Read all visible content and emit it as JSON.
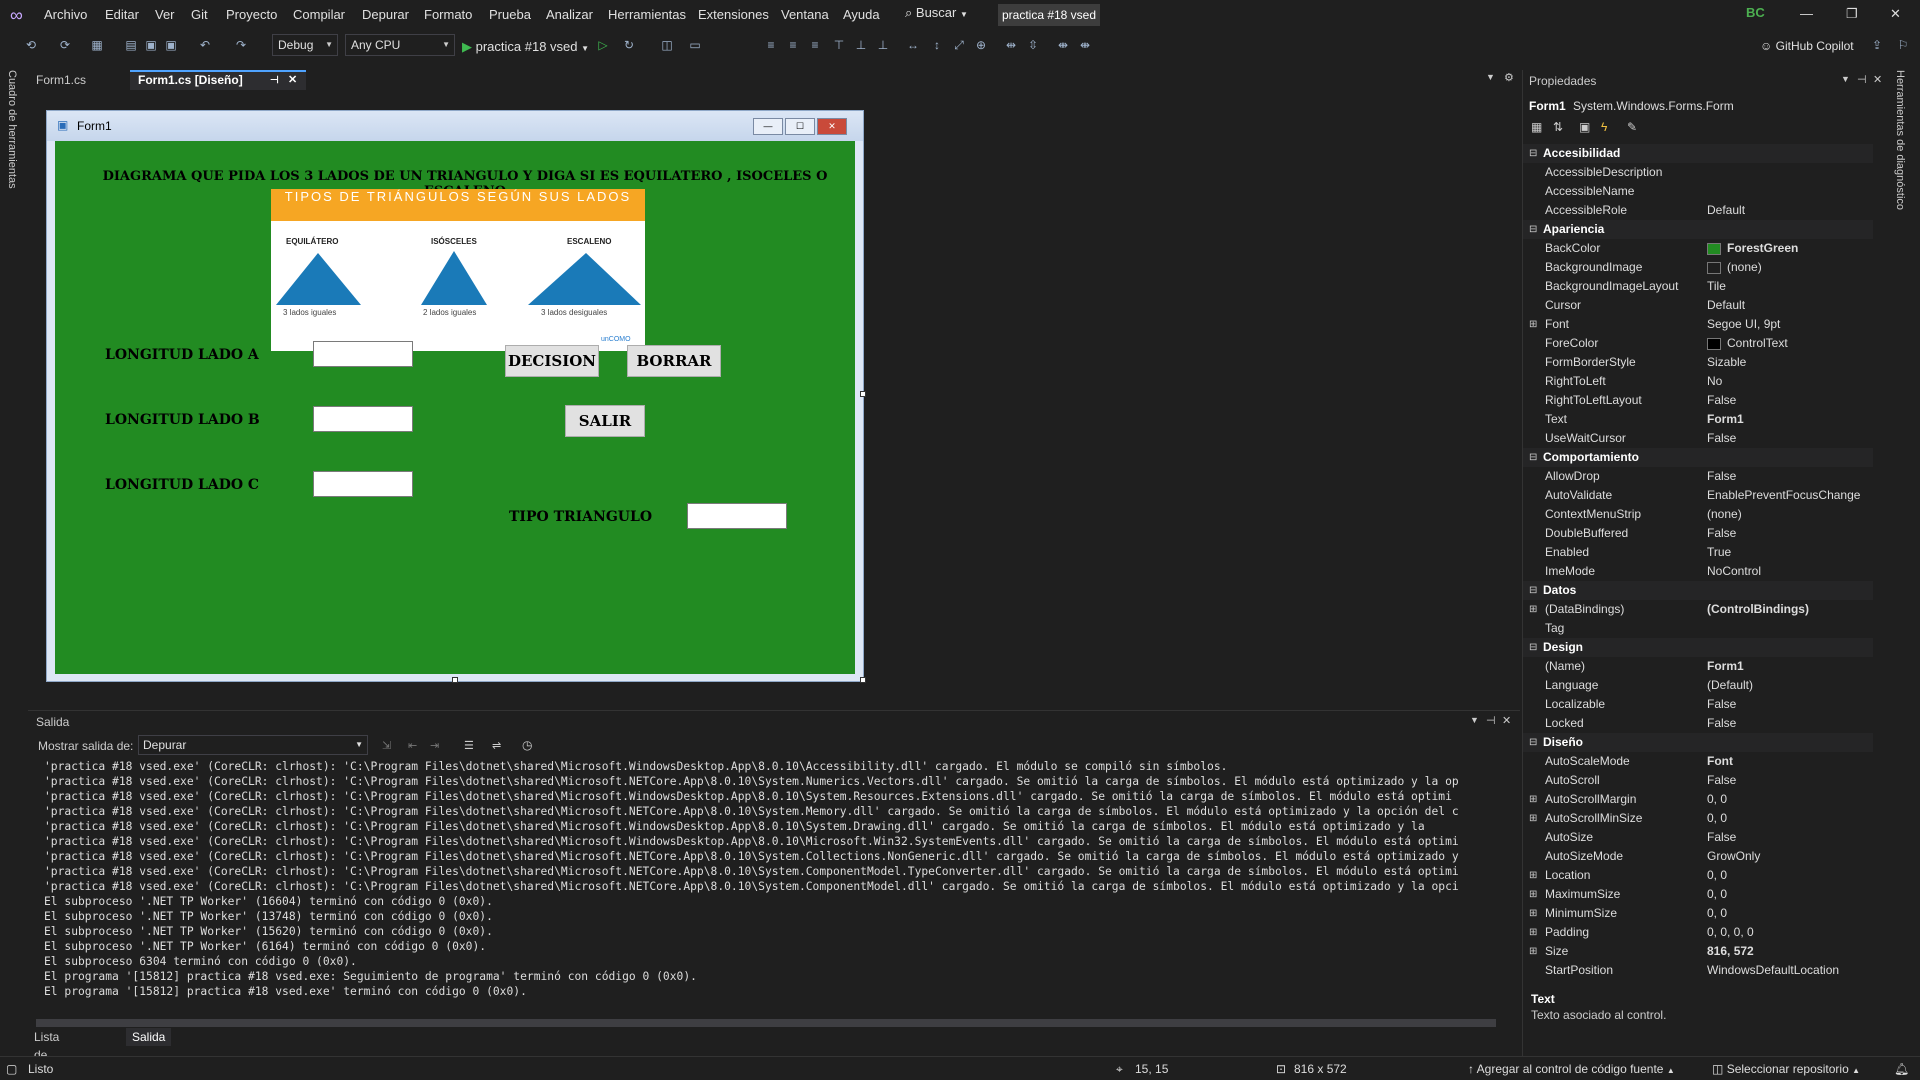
{
  "menu": {
    "items": [
      "Archivo",
      "Editar",
      "Ver",
      "Git",
      "Proyecto",
      "Compilar",
      "Depurar",
      "Formato",
      "Prueba",
      "Analizar",
      "Herramientas",
      "Extensiones",
      "Ventana",
      "Ayuda"
    ],
    "search": "Buscar",
    "solution_title": "practica #18 vsed",
    "avatar": "BC"
  },
  "toolbar": {
    "config": "Debug",
    "platform": "Any CPU",
    "run_label": "practica #18 vsed",
    "copilot": "GitHub Copilot"
  },
  "sidebars": {
    "left": "Cuadro de herramientas",
    "right": "Herramientas de diagnóstico"
  },
  "doc_tabs": [
    "Form1.cs",
    "Form1.cs [Diseño]"
  ],
  "form": {
    "title": "Form1",
    "heading": "DIAGRAMA QUE PIDA LOS 3 LADOS DE UN TRIANGULO Y DIGA SI ES EQUILATERO , ISOCELES O ESCALENO",
    "picture": {
      "banner": "TIPOS DE TRIÁNGULOS SEGÚN SUS LADOS",
      "types": [
        {
          "name": "EQUILÁTERO",
          "desc": "3 lados iguales"
        },
        {
          "name": "ISÓSCELES",
          "desc": "2 lados iguales"
        },
        {
          "name": "ESCALENO",
          "desc": "3 lados desiguales"
        }
      ],
      "logo": "unCOMO",
      "color": "#1a7ab8"
    },
    "label_a": "LONGITUD LADO A",
    "label_b": "LONGITUD LADO B",
    "label_c": "LONGITUD LADO C",
    "label_tipo": "TIPO TRIANGULO",
    "btn_decision": "DECISION",
    "btn_borrar": "BORRAR",
    "btn_salir": "SALIR",
    "backcolor": "#228b22"
  },
  "output": {
    "title": "Salida",
    "show_label": "Mostrar salida de:",
    "source": "Depurar",
    "lines": [
      "'practica #18 vsed.exe' (CoreCLR: clrhost): 'C:\\Program Files\\dotnet\\shared\\Microsoft.WindowsDesktop.App\\8.0.10\\Accessibility.dll' cargado. El módulo se compiló sin símbolos.",
      "'practica #18 vsed.exe' (CoreCLR: clrhost): 'C:\\Program Files\\dotnet\\shared\\Microsoft.NETCore.App\\8.0.10\\System.Numerics.Vectors.dll' cargado. Se omitió la carga de símbolos. El módulo está optimizado y la op",
      "'practica #18 vsed.exe' (CoreCLR: clrhost): 'C:\\Program Files\\dotnet\\shared\\Microsoft.WindowsDesktop.App\\8.0.10\\System.Resources.Extensions.dll' cargado. Se omitió la carga de símbolos. El módulo está optimi",
      "'practica #18 vsed.exe' (CoreCLR: clrhost): 'C:\\Program Files\\dotnet\\shared\\Microsoft.NETCore.App\\8.0.10\\System.Memory.dll' cargado. Se omitió la carga de símbolos. El módulo está optimizado y la opción del c",
      "'practica #18 vsed.exe' (CoreCLR: clrhost): 'C:\\Program Files\\dotnet\\shared\\Microsoft.WindowsDesktop.App\\8.0.10\\System.Drawing.dll' cargado. Se omitió la carga de símbolos. El módulo está optimizado y la",
      "'practica #18 vsed.exe' (CoreCLR: clrhost): 'C:\\Program Files\\dotnet\\shared\\Microsoft.WindowsDesktop.App\\8.0.10\\Microsoft.Win32.SystemEvents.dll' cargado. Se omitió la carga de símbolos. El módulo está optimi",
      "'practica #18 vsed.exe' (CoreCLR: clrhost): 'C:\\Program Files\\dotnet\\shared\\Microsoft.NETCore.App\\8.0.10\\System.Collections.NonGeneric.dll' cargado. Se omitió la carga de símbolos. El módulo está optimizado y",
      "'practica #18 vsed.exe' (CoreCLR: clrhost): 'C:\\Program Files\\dotnet\\shared\\Microsoft.NETCore.App\\8.0.10\\System.ComponentModel.TypeConverter.dll' cargado. Se omitió la carga de símbolos. El módulo está optimi",
      "'practica #18 vsed.exe' (CoreCLR: clrhost): 'C:\\Program Files\\dotnet\\shared\\Microsoft.NETCore.App\\8.0.10\\System.ComponentModel.dll' cargado. Se omitió la carga de símbolos. El módulo está optimizado y la opci",
      "El subproceso '.NET TP Worker' (16604) terminó con código 0 (0x0).",
      "El subproceso '.NET TP Worker' (13748) terminó con código 0 (0x0).",
      "El subproceso '.NET TP Worker' (15620) terminó con código 0 (0x0).",
      "El subproceso '.NET TP Worker' (6164) terminó con código 0 (0x0).",
      "El subproceso 6304 terminó con código 0 (0x0).",
      "El programa '[15812] practica #18 vsed.exe: Seguimiento de programa' terminó con código 0 (0x0).",
      "El programa '[15812] practica #18 vsed.exe' terminó con código 0 (0x0)."
    ],
    "tabs": [
      "Lista de errores",
      "Salida"
    ]
  },
  "properties": {
    "title": "Propiedades",
    "object": "Form1",
    "object_type": "System.Windows.Forms.Form",
    "rows": [
      {
        "cat": true,
        "name": "Accesibilidad"
      },
      {
        "name": "AccessibleDescription",
        "value": ""
      },
      {
        "name": "AccessibleName",
        "value": ""
      },
      {
        "name": "AccessibleRole",
        "value": "Default"
      },
      {
        "cat": true,
        "name": "Apariencia"
      },
      {
        "name": "BackColor",
        "value": "ForestGreen",
        "swatch": "#228b22",
        "bold": true
      },
      {
        "name": "BackgroundImage",
        "value": "(none)",
        "swatch": "#1f1f1f"
      },
      {
        "name": "BackgroundImageLayout",
        "value": "Tile"
      },
      {
        "name": "Cursor",
        "value": "Default"
      },
      {
        "name": "Font",
        "value": "Segoe UI, 9pt",
        "exp": true
      },
      {
        "name": "ForeColor",
        "value": "ControlText",
        "swatch": "#000000"
      },
      {
        "name": "FormBorderStyle",
        "value": "Sizable"
      },
      {
        "name": "RightToLeft",
        "value": "No"
      },
      {
        "name": "RightToLeftLayout",
        "value": "False"
      },
      {
        "name": "Text",
        "value": "Form1",
        "bold": true
      },
      {
        "name": "UseWaitCursor",
        "value": "False"
      },
      {
        "cat": true,
        "name": "Comportamiento"
      },
      {
        "name": "AllowDrop",
        "value": "False"
      },
      {
        "name": "AutoValidate",
        "value": "EnablePreventFocusChange"
      },
      {
        "name": "ContextMenuStrip",
        "value": "(none)"
      },
      {
        "name": "DoubleBuffered",
        "value": "False"
      },
      {
        "name": "Enabled",
        "value": "True"
      },
      {
        "name": "ImeMode",
        "value": "NoControl"
      },
      {
        "cat": true,
        "name": "Datos"
      },
      {
        "name": "(DataBindings)",
        "value": "(ControlBindings)",
        "exp": true,
        "bold": true
      },
      {
        "name": "Tag",
        "value": ""
      },
      {
        "cat": true,
        "name": "Design"
      },
      {
        "name": "(Name)",
        "value": "Form1",
        "bold": true
      },
      {
        "name": "Language",
        "value": "(Default)"
      },
      {
        "name": "Localizable",
        "value": "False"
      },
      {
        "name": "Locked",
        "value": "False"
      },
      {
        "cat": true,
        "name": "Diseño"
      },
      {
        "name": "AutoScaleMode",
        "value": "Font",
        "bold": true
      },
      {
        "name": "AutoScroll",
        "value": "False"
      },
      {
        "name": "AutoScrollMargin",
        "value": "0, 0",
        "exp": true
      },
      {
        "name": "AutoScrollMinSize",
        "value": "0, 0",
        "exp": true
      },
      {
        "name": "AutoSize",
        "value": "False"
      },
      {
        "name": "AutoSizeMode",
        "value": "GrowOnly"
      },
      {
        "name": "Location",
        "value": "0, 0",
        "exp": true
      },
      {
        "name": "MaximumSize",
        "value": "0, 0",
        "exp": true
      },
      {
        "name": "MinimumSize",
        "value": "0, 0",
        "exp": true
      },
      {
        "name": "Padding",
        "value": "0, 0, 0, 0",
        "exp": true
      },
      {
        "name": "Size",
        "value": "816, 572",
        "exp": true,
        "bold": true
      },
      {
        "name": "StartPosition",
        "value": "WindowsDefaultLocation"
      }
    ],
    "desc_title": "Text",
    "desc_text": "Texto asociado al control."
  },
  "status": {
    "ready": "Listo",
    "position": "15, 15",
    "size": "816 x 572",
    "source_control": "Agregar al control de código fuente",
    "repo": "Seleccionar repositorio"
  }
}
